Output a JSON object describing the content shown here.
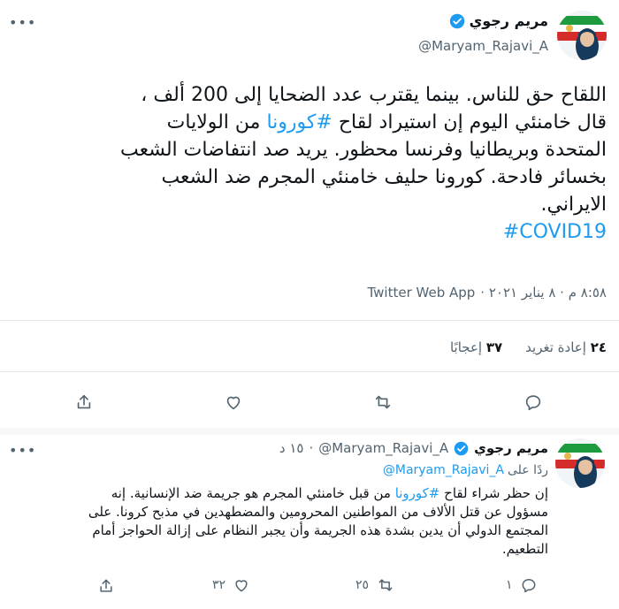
{
  "tweet": {
    "author_name": "مريم رجوي",
    "author_handle": "@Maryam_Rajavi_A",
    "more_icon": "more-dots-icon",
    "verified_icon": "verified-badge-icon",
    "body_lines": [
      "اللقاح حق للناس. بينما يقترب عدد الضحايا إلى 200 ألف ،",
      "قال خامنئي اليوم إن استيراد لقاح",
      "من الولايات",
      "المتحدة وبريطانيا وفرنسا محظور. يريد صد انتفاضات الشعب",
      "بخسائر فادحة. كورونا حليف خامنئي المجرم ضد الشعب",
      "الايراني."
    ],
    "hashtag_corona": "#كورونا",
    "hashtag_covid": "#COVID19",
    "meta_time_date": "٨:٥٨ م · ٨ يناير ٢٠٢١ ·",
    "meta_source": "Twitter Web App",
    "stats": {
      "retweets_count": "٢٤",
      "retweets_label": "إعادة تغريد",
      "likes_count": "٣٧",
      "likes_label": "إعجابًا"
    },
    "actions": {
      "reply": "reply-icon",
      "retweet": "retweet-icon",
      "like": "heart-icon",
      "share": "share-icon"
    }
  },
  "reply": {
    "author_name": "مريم رجوي",
    "author_handle": "@Maryam_Rajavi_A",
    "time_ago": "١٥ د",
    "replying_prefix": "ردًا على",
    "replying_to": "@Maryam_Rajavi_A",
    "body_line1_a": "إن حظر شراء لقاح",
    "body_line1_hashtag": "#كورونا",
    "body_line1_b": "من قبل خامنئي المجرم هو جريمة ضد الإنسانية. إنه",
    "body_line2": "مسؤول عن قتل الألاف من المواطنين المحرومين والمضطهدين في مذبح كرونا. على",
    "body_line3": "المجتمع الدولي أن يدين بشدة هذه الجريمة وأن يجبر النظام على إزالة الحواجز أمام",
    "body_line4": "التطعيم.",
    "counts": {
      "replies": "١",
      "retweets": "٢٥",
      "likes": "٣٢"
    }
  }
}
